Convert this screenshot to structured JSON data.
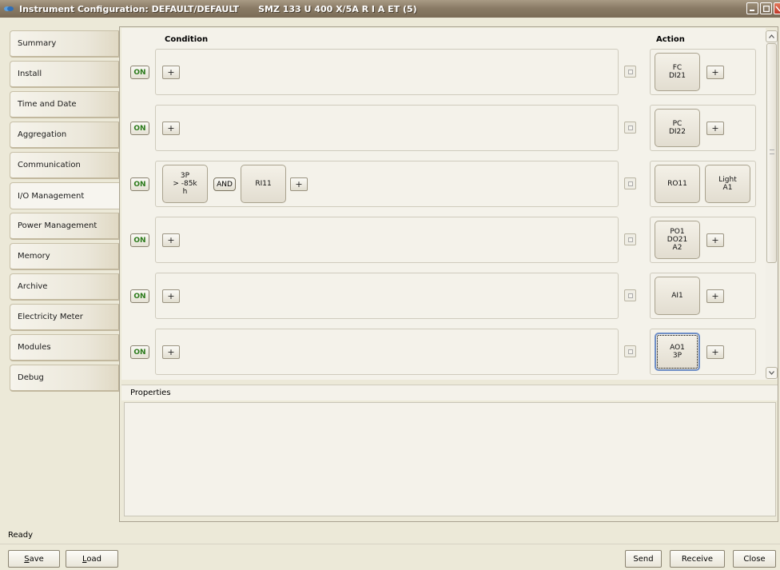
{
  "window": {
    "title": "Instrument Configuration: DEFAULT/DEFAULT",
    "device": "SMZ 133 U 400 X/5A R I A ET (5)"
  },
  "nav": {
    "items": [
      {
        "label": "Summary"
      },
      {
        "label": "Install"
      },
      {
        "label": "Time and Date"
      },
      {
        "label": "Aggregation"
      },
      {
        "label": "Communication"
      },
      {
        "label": "I/O Management",
        "active": true
      },
      {
        "label": "Power Management"
      },
      {
        "label": "Memory"
      },
      {
        "label": "Archive"
      },
      {
        "label": "Electricity Meter"
      },
      {
        "label": "Modules"
      },
      {
        "label": "Debug"
      }
    ]
  },
  "rules": {
    "condition_header": "Condition",
    "action_header": "Action",
    "on_label": "ON",
    "plus_label": "+",
    "and_label": "AND",
    "rows": [
      {
        "conditions": [],
        "actions": [
          "FC\nDI21"
        ],
        "action_plus": true
      },
      {
        "conditions": [],
        "actions": [
          "PC\nDI22"
        ],
        "action_plus": true
      },
      {
        "conditions": [
          "3P\n> -85k\nh",
          "RI11"
        ],
        "actions": [
          "RO11",
          "Light\nA1"
        ],
        "action_plus": false
      },
      {
        "conditions": [],
        "actions": [
          "PO1\nDO21\nA2"
        ],
        "action_plus": true
      },
      {
        "conditions": [],
        "actions": [
          "AI1"
        ],
        "action_plus": true
      },
      {
        "conditions": [],
        "actions": [
          "AO1\n3P"
        ],
        "action_plus": true
      }
    ]
  },
  "properties": {
    "label": "Properties"
  },
  "status": {
    "text": "Ready"
  },
  "buttons": {
    "save": "Save",
    "load": "Load",
    "send": "Send",
    "receive": "Receive",
    "close": "Close"
  }
}
